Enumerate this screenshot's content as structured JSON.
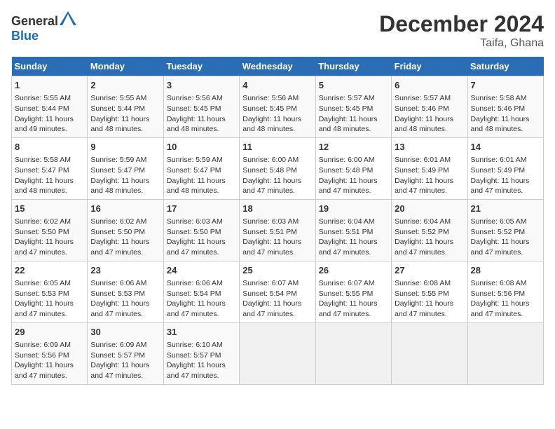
{
  "header": {
    "logo_general": "General",
    "logo_blue": "Blue",
    "month_year": "December 2024",
    "location": "Taifa, Ghana"
  },
  "days_of_week": [
    "Sunday",
    "Monday",
    "Tuesday",
    "Wednesday",
    "Thursday",
    "Friday",
    "Saturday"
  ],
  "weeks": [
    [
      {
        "day": "1",
        "info": "Sunrise: 5:55 AM\nSunset: 5:44 PM\nDaylight: 11 hours and 49 minutes."
      },
      {
        "day": "2",
        "info": "Sunrise: 5:55 AM\nSunset: 5:44 PM\nDaylight: 11 hours and 48 minutes."
      },
      {
        "day": "3",
        "info": "Sunrise: 5:56 AM\nSunset: 5:45 PM\nDaylight: 11 hours and 48 minutes."
      },
      {
        "day": "4",
        "info": "Sunrise: 5:56 AM\nSunset: 5:45 PM\nDaylight: 11 hours and 48 minutes."
      },
      {
        "day": "5",
        "info": "Sunrise: 5:57 AM\nSunset: 5:45 PM\nDaylight: 11 hours and 48 minutes."
      },
      {
        "day": "6",
        "info": "Sunrise: 5:57 AM\nSunset: 5:46 PM\nDaylight: 11 hours and 48 minutes."
      },
      {
        "day": "7",
        "info": "Sunrise: 5:58 AM\nSunset: 5:46 PM\nDaylight: 11 hours and 48 minutes."
      }
    ],
    [
      {
        "day": "8",
        "info": "Sunrise: 5:58 AM\nSunset: 5:47 PM\nDaylight: 11 hours and 48 minutes."
      },
      {
        "day": "9",
        "info": "Sunrise: 5:59 AM\nSunset: 5:47 PM\nDaylight: 11 hours and 48 minutes."
      },
      {
        "day": "10",
        "info": "Sunrise: 5:59 AM\nSunset: 5:47 PM\nDaylight: 11 hours and 48 minutes."
      },
      {
        "day": "11",
        "info": "Sunrise: 6:00 AM\nSunset: 5:48 PM\nDaylight: 11 hours and 47 minutes."
      },
      {
        "day": "12",
        "info": "Sunrise: 6:00 AM\nSunset: 5:48 PM\nDaylight: 11 hours and 47 minutes."
      },
      {
        "day": "13",
        "info": "Sunrise: 6:01 AM\nSunset: 5:49 PM\nDaylight: 11 hours and 47 minutes."
      },
      {
        "day": "14",
        "info": "Sunrise: 6:01 AM\nSunset: 5:49 PM\nDaylight: 11 hours and 47 minutes."
      }
    ],
    [
      {
        "day": "15",
        "info": "Sunrise: 6:02 AM\nSunset: 5:50 PM\nDaylight: 11 hours and 47 minutes."
      },
      {
        "day": "16",
        "info": "Sunrise: 6:02 AM\nSunset: 5:50 PM\nDaylight: 11 hours and 47 minutes."
      },
      {
        "day": "17",
        "info": "Sunrise: 6:03 AM\nSunset: 5:50 PM\nDaylight: 11 hours and 47 minutes."
      },
      {
        "day": "18",
        "info": "Sunrise: 6:03 AM\nSunset: 5:51 PM\nDaylight: 11 hours and 47 minutes."
      },
      {
        "day": "19",
        "info": "Sunrise: 6:04 AM\nSunset: 5:51 PM\nDaylight: 11 hours and 47 minutes."
      },
      {
        "day": "20",
        "info": "Sunrise: 6:04 AM\nSunset: 5:52 PM\nDaylight: 11 hours and 47 minutes."
      },
      {
        "day": "21",
        "info": "Sunrise: 6:05 AM\nSunset: 5:52 PM\nDaylight: 11 hours and 47 minutes."
      }
    ],
    [
      {
        "day": "22",
        "info": "Sunrise: 6:05 AM\nSunset: 5:53 PM\nDaylight: 11 hours and 47 minutes."
      },
      {
        "day": "23",
        "info": "Sunrise: 6:06 AM\nSunset: 5:53 PM\nDaylight: 11 hours and 47 minutes."
      },
      {
        "day": "24",
        "info": "Sunrise: 6:06 AM\nSunset: 5:54 PM\nDaylight: 11 hours and 47 minutes."
      },
      {
        "day": "25",
        "info": "Sunrise: 6:07 AM\nSunset: 5:54 PM\nDaylight: 11 hours and 47 minutes."
      },
      {
        "day": "26",
        "info": "Sunrise: 6:07 AM\nSunset: 5:55 PM\nDaylight: 11 hours and 47 minutes."
      },
      {
        "day": "27",
        "info": "Sunrise: 6:08 AM\nSunset: 5:55 PM\nDaylight: 11 hours and 47 minutes."
      },
      {
        "day": "28",
        "info": "Sunrise: 6:08 AM\nSunset: 5:56 PM\nDaylight: 11 hours and 47 minutes."
      }
    ],
    [
      {
        "day": "29",
        "info": "Sunrise: 6:09 AM\nSunset: 5:56 PM\nDaylight: 11 hours and 47 minutes."
      },
      {
        "day": "30",
        "info": "Sunrise: 6:09 AM\nSunset: 5:57 PM\nDaylight: 11 hours and 47 minutes."
      },
      {
        "day": "31",
        "info": "Sunrise: 6:10 AM\nSunset: 5:57 PM\nDaylight: 11 hours and 47 minutes."
      },
      {
        "day": "",
        "info": ""
      },
      {
        "day": "",
        "info": ""
      },
      {
        "day": "",
        "info": ""
      },
      {
        "day": "",
        "info": ""
      }
    ]
  ]
}
